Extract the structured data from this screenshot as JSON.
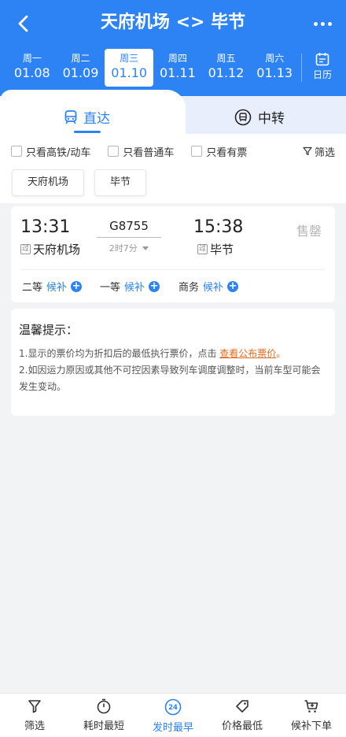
{
  "header": {
    "title": "天府机场 <> 毕节",
    "back_icon": "back-arrow-icon",
    "more_icon": "more-dots-icon"
  },
  "dates": [
    {
      "weekday": "周一",
      "date": "01.08"
    },
    {
      "weekday": "周二",
      "date": "01.09"
    },
    {
      "weekday": "周三",
      "date": "01.10",
      "selected": true
    },
    {
      "weekday": "周四",
      "date": "01.11"
    },
    {
      "weekday": "周五",
      "date": "01.12"
    },
    {
      "weekday": "周六",
      "date": "01.13"
    }
  ],
  "calendar": {
    "label": "日历",
    "icon": "calendar-icon"
  },
  "tabs": {
    "direct": "直达",
    "transfer": "中转",
    "active": "direct"
  },
  "filters": {
    "high_speed": "只看高铁/动车",
    "normal": "只看普通车",
    "available": "只看有票",
    "screen": "筛选"
  },
  "stations": {
    "from": "天府机场",
    "to": "毕节"
  },
  "train": {
    "depart_time": "13:31",
    "arrive_time": "15:38",
    "number": "G8755",
    "duration": "2时7分",
    "status": "售罄",
    "pass_tag": "过",
    "from_station": "天府机场",
    "to_station": "毕节",
    "seats": [
      {
        "class": "二等",
        "status": "候补"
      },
      {
        "class": "一等",
        "status": "候补"
      },
      {
        "class": "商务",
        "status": "候补"
      }
    ]
  },
  "tips": {
    "title": "温馨提示：",
    "line1_prefix": "1.显示的票价均为折扣后的最低执行票价，点击 ",
    "line1_link": "查看公布票价",
    "line1_suffix": "。",
    "line2": "2.如因运力原因或其他不可控因素导致列车调度调整时，当前车型可能会发生变动。"
  },
  "bottom_nav": {
    "filter": "筛选",
    "shortest": "耗时最短",
    "earliest": "发时最早",
    "cheapest": "价格最低",
    "waitlist": "候补下单",
    "earliest_badge": "24",
    "active": "earliest"
  },
  "colors": {
    "accent": "#2d83f3",
    "link": "#e46b1e",
    "soldout": "#b5b5b5"
  }
}
